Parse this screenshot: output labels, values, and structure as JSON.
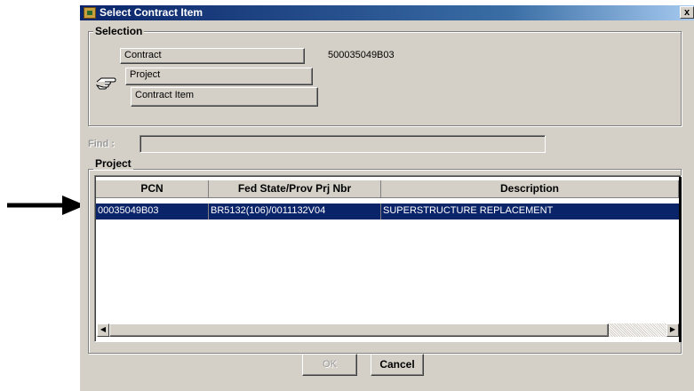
{
  "window": {
    "title": "Select Contract Item",
    "close_label": "x"
  },
  "selection": {
    "label": "Selection",
    "contract_label": "Contract",
    "contract_value": "500035049B03",
    "project_label": "Project",
    "contract_item_label": "Contract Item",
    "pointer_icon": "hand-pointer-icon"
  },
  "find": {
    "label": "Find :",
    "value": ""
  },
  "project": {
    "label": "Project",
    "columns": [
      "PCN",
      "Fed State/Prov Prj Nbr",
      "Description"
    ],
    "rows": [
      {
        "pcn": "00035049B03",
        "fed_nbr": "BR5132(106)/0011132V04",
        "description": "SUPERSTRUCTURE REPLACEMENT",
        "selected": true
      }
    ]
  },
  "buttons": {
    "ok_label": "OK",
    "cancel_label": "Cancel"
  },
  "annotation": {
    "arrow_icon": "right-arrow-icon"
  },
  "colors": {
    "title_bar": "#0a246a",
    "selected_row": "#0a246a",
    "window_face": "#d4d0c8"
  }
}
